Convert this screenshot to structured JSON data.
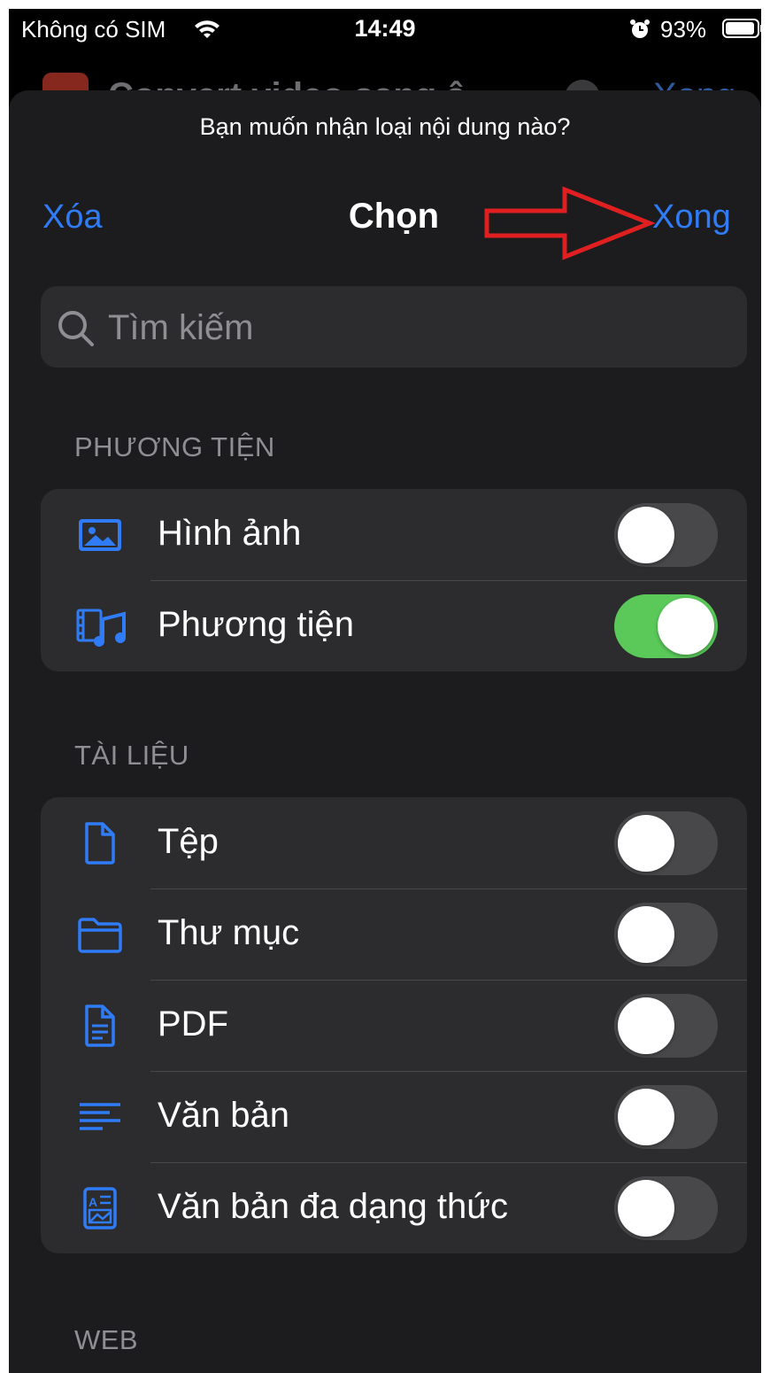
{
  "status_bar": {
    "carrier": "Không có SIM",
    "time": "14:49",
    "battery": "93%"
  },
  "background": {
    "title": "Convert video sang â",
    "done": "Xong"
  },
  "sheet": {
    "prompt": "Bạn muốn nhận loại nội dung nào?",
    "clear_label": "Xóa",
    "title": "Chọn",
    "done_label": "Xong",
    "search_placeholder": "Tìm kiếm"
  },
  "sections": [
    {
      "header": "PHƯƠNG TIỆN",
      "items": [
        {
          "label": "Hình ảnh",
          "icon": "photo-icon",
          "enabled": false
        },
        {
          "label": "Phương tiện",
          "icon": "media-icon",
          "enabled": true
        }
      ]
    },
    {
      "header": "TÀI LIỆU",
      "items": [
        {
          "label": "Tệp",
          "icon": "file-icon",
          "enabled": false
        },
        {
          "label": "Thư mục",
          "icon": "folder-icon",
          "enabled": false
        },
        {
          "label": "PDF",
          "icon": "pdf-document-icon",
          "enabled": false
        },
        {
          "label": "Văn bản",
          "icon": "text-lines-icon",
          "enabled": false
        },
        {
          "label": "Văn bản đa dạng thức",
          "icon": "rich-text-icon",
          "enabled": false
        }
      ]
    },
    {
      "header": "WEB",
      "items": []
    }
  ],
  "colors": {
    "accent": "#2f7cf6",
    "toggle_on": "#5ac95a",
    "annotation_arrow": "#e02020"
  }
}
